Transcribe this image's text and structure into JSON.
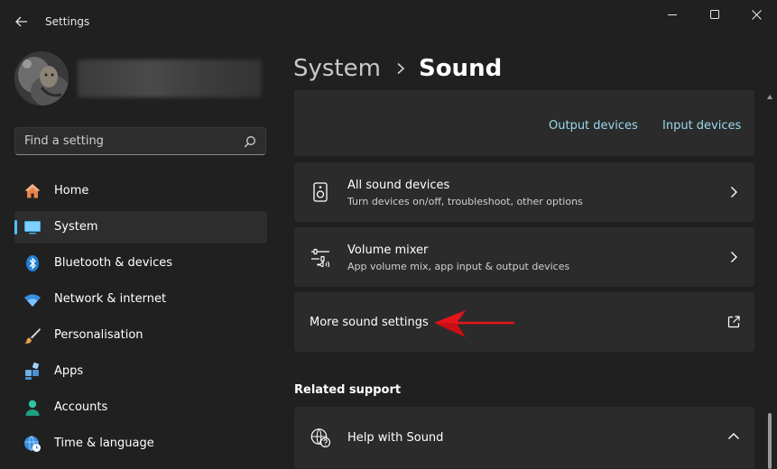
{
  "window": {
    "title": "Settings"
  },
  "search": {
    "placeholder": "Find a setting"
  },
  "sidebar": {
    "items": [
      {
        "label": "Home",
        "icon": "home-icon"
      },
      {
        "label": "System",
        "icon": "system-icon",
        "active": true
      },
      {
        "label": "Bluetooth & devices",
        "icon": "bluetooth-icon"
      },
      {
        "label": "Network & internet",
        "icon": "wifi-icon"
      },
      {
        "label": "Personalisation",
        "icon": "brush-icon"
      },
      {
        "label": "Apps",
        "icon": "apps-icon"
      },
      {
        "label": "Accounts",
        "icon": "account-icon"
      },
      {
        "label": "Time & language",
        "icon": "globe-clock-icon"
      }
    ]
  },
  "header": {
    "parent": "System",
    "current": "Sound"
  },
  "main": {
    "top_links": {
      "output": "Output devices",
      "input": "Input devices"
    },
    "rows": [
      {
        "title": "All sound devices",
        "subtitle": "Turn devices on/off, troubleshoot, other options",
        "icon": "speaker-icon"
      },
      {
        "title": "Volume mixer",
        "subtitle": "App volume mix, app input & output devices",
        "icon": "mixer-icon"
      },
      {
        "title": "More sound settings",
        "icon": "external-link-icon"
      }
    ],
    "related_support": {
      "heading": "Related support",
      "items": [
        {
          "title": "Help with Sound",
          "icon": "help-globe-icon"
        }
      ]
    }
  },
  "colors": {
    "background": "#202020",
    "card": "#2b2b2b",
    "accent": "#4cc2ff",
    "link": "#99d9ec",
    "annotation_arrow": "#e8141b"
  }
}
